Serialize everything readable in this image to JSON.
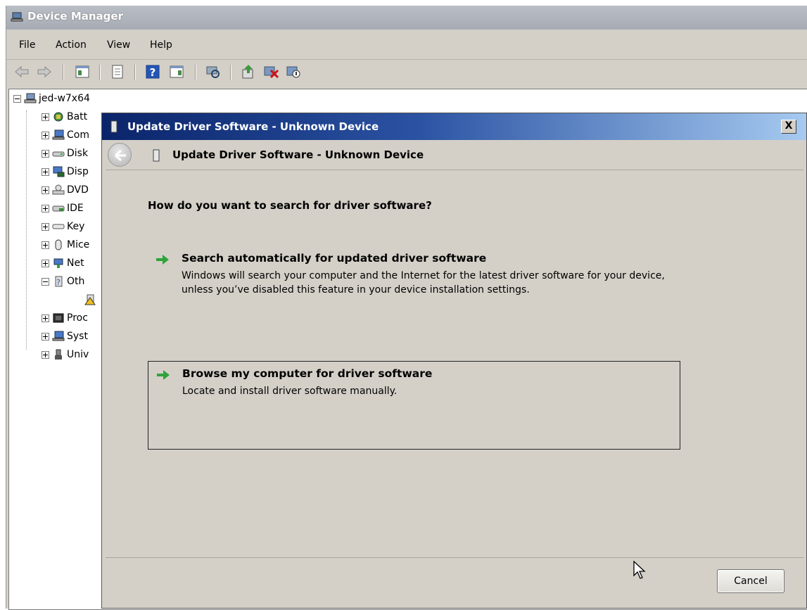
{
  "window": {
    "title": "Device Manager",
    "menu": [
      "File",
      "Action",
      "View",
      "Help"
    ],
    "toolbar_icons": [
      "back-icon",
      "forward-icon",
      "show-hide-console-tree-icon",
      "properties-icon",
      "help-icon",
      "show-action-pane-icon",
      "scan-hardware-icon",
      "update-driver-icon",
      "uninstall-device-icon",
      "disable-device-icon"
    ]
  },
  "tree": {
    "root": "jed-w7x64",
    "items": [
      {
        "label": "Batt",
        "icon": "battery-icon"
      },
      {
        "label": "Com",
        "icon": "computer-icon"
      },
      {
        "label": "Disk",
        "icon": "disk-drive-icon"
      },
      {
        "label": "Disp",
        "icon": "display-adapter-icon"
      },
      {
        "label": "DVD",
        "icon": "dvd-drive-icon"
      },
      {
        "label": "IDE",
        "icon": "ide-controller-icon"
      },
      {
        "label": "Key",
        "icon": "keyboard-icon"
      },
      {
        "label": "Mice",
        "icon": "mouse-icon"
      },
      {
        "label": "Net",
        "icon": "network-adapter-icon"
      },
      {
        "label": "Oth",
        "icon": "other-devices-icon"
      },
      {
        "label": "",
        "icon": "unknown-device-warning-icon"
      },
      {
        "label": "Proc",
        "icon": "processor-icon"
      },
      {
        "label": "Syst",
        "icon": "system-devices-icon"
      },
      {
        "label": "Univ",
        "icon": "usb-controller-icon"
      }
    ]
  },
  "dialog": {
    "title": "Update Driver Software - Unknown Device",
    "header": "Update Driver Software - Unknown Device",
    "question": "How do you want to search for driver software?",
    "options": [
      {
        "title": "Search automatically for updated driver software",
        "description": "Windows will search your computer and the Internet for the latest driver software for your device, unless you’ve disabled this feature in your device installation settings."
      },
      {
        "title": "Browse my computer for driver software",
        "description": "Locate and install driver software manually."
      }
    ],
    "cancel_label": "Cancel",
    "close_label": "X"
  },
  "colors": {
    "dialog_title_start": "#0a246a",
    "dialog_title_end": "#a6caf0",
    "arrow_green": "#2ea43a"
  }
}
